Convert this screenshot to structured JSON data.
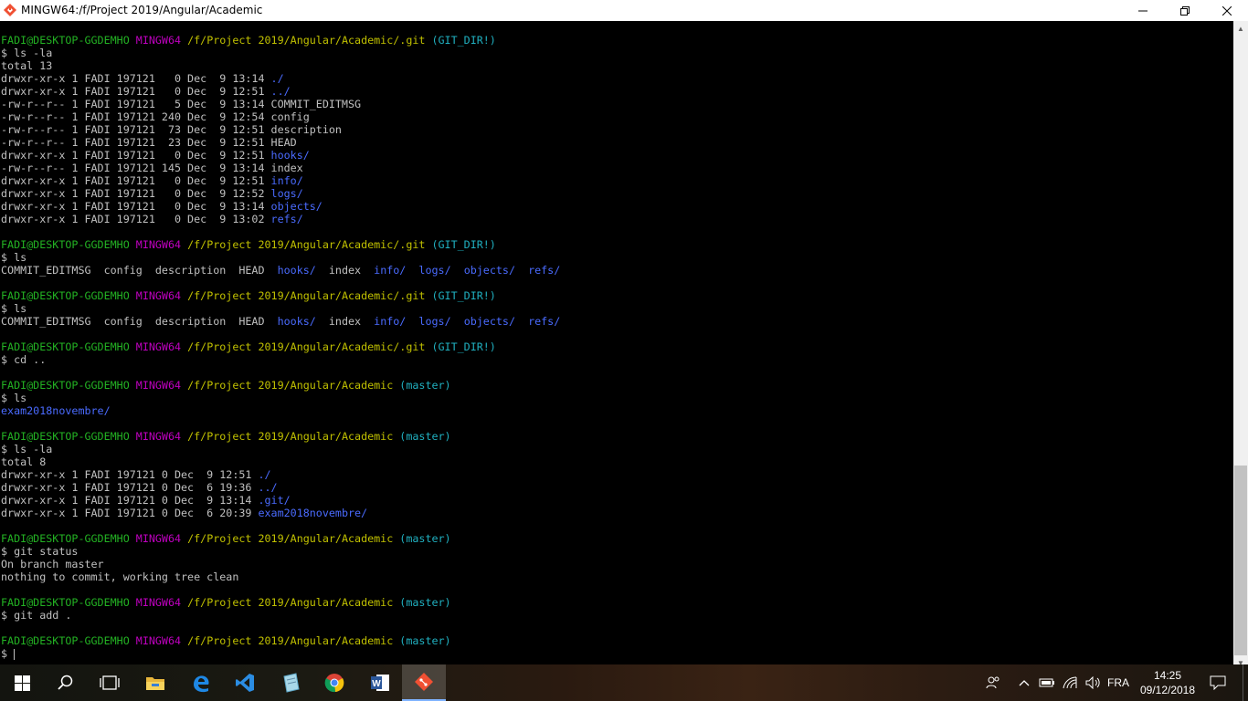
{
  "window": {
    "title": "MINGW64:/f/Project 2019/Angular/Academic",
    "minimize_glyph": "—",
    "maximize_glyph": "❐",
    "close_glyph": "✕"
  },
  "terminal": {
    "lines": [
      [
        [
          "FADI@DESKTOP-GGDEMHO ",
          "user"
        ],
        [
          "MINGW64 ",
          "sys"
        ],
        [
          "/f/Project 2019/Angular/Academic/.git ",
          "path"
        ],
        [
          "(GIT_DIR!)",
          "branch"
        ]
      ],
      [
        [
          "$ ls -la",
          "plain"
        ]
      ],
      [
        [
          "total 13",
          "plain"
        ]
      ],
      [
        [
          "drwxr-xr-x 1 FADI 197121   0 Dec  9 13:14 ",
          "plain"
        ],
        [
          "./",
          "dir"
        ]
      ],
      [
        [
          "drwxr-xr-x 1 FADI 197121   0 Dec  9 12:51 ",
          "plain"
        ],
        [
          "../",
          "dir"
        ]
      ],
      [
        [
          "-rw-r--r-- 1 FADI 197121   5 Dec  9 13:14 COMMIT_EDITMSG",
          "plain"
        ]
      ],
      [
        [
          "-rw-r--r-- 1 FADI 197121 240 Dec  9 12:54 config",
          "plain"
        ]
      ],
      [
        [
          "-rw-r--r-- 1 FADI 197121  73 Dec  9 12:51 description",
          "plain"
        ]
      ],
      [
        [
          "-rw-r--r-- 1 FADI 197121  23 Dec  9 12:51 HEAD",
          "plain"
        ]
      ],
      [
        [
          "drwxr-xr-x 1 FADI 197121   0 Dec  9 12:51 ",
          "plain"
        ],
        [
          "hooks/",
          "dir"
        ]
      ],
      [
        [
          "-rw-r--r-- 1 FADI 197121 145 Dec  9 13:14 index",
          "plain"
        ]
      ],
      [
        [
          "drwxr-xr-x 1 FADI 197121   0 Dec  9 12:51 ",
          "plain"
        ],
        [
          "info/",
          "dir"
        ]
      ],
      [
        [
          "drwxr-xr-x 1 FADI 197121   0 Dec  9 12:52 ",
          "plain"
        ],
        [
          "logs/",
          "dir"
        ]
      ],
      [
        [
          "drwxr-xr-x 1 FADI 197121   0 Dec  9 13:14 ",
          "plain"
        ],
        [
          "objects/",
          "dir"
        ]
      ],
      [
        [
          "drwxr-xr-x 1 FADI 197121   0 Dec  9 13:02 ",
          "plain"
        ],
        [
          "refs/",
          "dir"
        ]
      ],
      [],
      [
        [
          "FADI@DESKTOP-GGDEMHO ",
          "user"
        ],
        [
          "MINGW64 ",
          "sys"
        ],
        [
          "/f/Project 2019/Angular/Academic/.git ",
          "path"
        ],
        [
          "(GIT_DIR!)",
          "branch"
        ]
      ],
      [
        [
          "$ ls",
          "plain"
        ]
      ],
      [
        [
          "COMMIT_EDITMSG  config  description  HEAD  ",
          "plain"
        ],
        [
          "hooks/",
          "dir"
        ],
        [
          "  index  ",
          "plain"
        ],
        [
          "info/",
          "dir"
        ],
        [
          "  ",
          "plain"
        ],
        [
          "logs/",
          "dir"
        ],
        [
          "  ",
          "plain"
        ],
        [
          "objects/",
          "dir"
        ],
        [
          "  ",
          "plain"
        ],
        [
          "refs/",
          "dir"
        ]
      ],
      [],
      [
        [
          "FADI@DESKTOP-GGDEMHO ",
          "user"
        ],
        [
          "MINGW64 ",
          "sys"
        ],
        [
          "/f/Project 2019/Angular/Academic/.git ",
          "path"
        ],
        [
          "(GIT_DIR!)",
          "branch"
        ]
      ],
      [
        [
          "$ ls",
          "plain"
        ]
      ],
      [
        [
          "COMMIT_EDITMSG  config  description  HEAD  ",
          "plain"
        ],
        [
          "hooks/",
          "dir"
        ],
        [
          "  index  ",
          "plain"
        ],
        [
          "info/",
          "dir"
        ],
        [
          "  ",
          "plain"
        ],
        [
          "logs/",
          "dir"
        ],
        [
          "  ",
          "plain"
        ],
        [
          "objects/",
          "dir"
        ],
        [
          "  ",
          "plain"
        ],
        [
          "refs/",
          "dir"
        ]
      ],
      [],
      [
        [
          "FADI@DESKTOP-GGDEMHO ",
          "user"
        ],
        [
          "MINGW64 ",
          "sys"
        ],
        [
          "/f/Project 2019/Angular/Academic/.git ",
          "path"
        ],
        [
          "(GIT_DIR!)",
          "branch"
        ]
      ],
      [
        [
          "$ cd ..",
          "plain"
        ]
      ],
      [],
      [
        [
          "FADI@DESKTOP-GGDEMHO ",
          "user"
        ],
        [
          "MINGW64 ",
          "sys"
        ],
        [
          "/f/Project 2019/Angular/Academic ",
          "path"
        ],
        [
          "(master)",
          "branch"
        ]
      ],
      [
        [
          "$ ls",
          "plain"
        ]
      ],
      [
        [
          "exam2018novembre/",
          "dir"
        ]
      ],
      [],
      [
        [
          "FADI@DESKTOP-GGDEMHO ",
          "user"
        ],
        [
          "MINGW64 ",
          "sys"
        ],
        [
          "/f/Project 2019/Angular/Academic ",
          "path"
        ],
        [
          "(master)",
          "branch"
        ]
      ],
      [
        [
          "$ ls -la",
          "plain"
        ]
      ],
      [
        [
          "total 8",
          "plain"
        ]
      ],
      [
        [
          "drwxr-xr-x 1 FADI 197121 0 Dec  9 12:51 ",
          "plain"
        ],
        [
          "./",
          "dir"
        ]
      ],
      [
        [
          "drwxr-xr-x 1 FADI 197121 0 Dec  6 19:36 ",
          "plain"
        ],
        [
          "../",
          "dir"
        ]
      ],
      [
        [
          "drwxr-xr-x 1 FADI 197121 0 Dec  9 13:14 ",
          "plain"
        ],
        [
          ".git/",
          "dir"
        ]
      ],
      [
        [
          "drwxr-xr-x 1 FADI 197121 0 Dec  6 20:39 ",
          "plain"
        ],
        [
          "exam2018novembre/",
          "dir"
        ]
      ],
      [],
      [
        [
          "FADI@DESKTOP-GGDEMHO ",
          "user"
        ],
        [
          "MINGW64 ",
          "sys"
        ],
        [
          "/f/Project 2019/Angular/Academic ",
          "path"
        ],
        [
          "(master)",
          "branch"
        ]
      ],
      [
        [
          "$ git status",
          "plain"
        ]
      ],
      [
        [
          "On branch master",
          "plain"
        ]
      ],
      [
        [
          "nothing to commit, working tree clean",
          "plain"
        ]
      ],
      [],
      [
        [
          "FADI@DESKTOP-GGDEMHO ",
          "user"
        ],
        [
          "MINGW64 ",
          "sys"
        ],
        [
          "/f/Project 2019/Angular/Academic ",
          "path"
        ],
        [
          "(master)",
          "branch"
        ]
      ],
      [
        [
          "$ git add .",
          "plain"
        ]
      ],
      [],
      [
        [
          "FADI@DESKTOP-GGDEMHO ",
          "user"
        ],
        [
          "MINGW64 ",
          "sys"
        ],
        [
          "/f/Project 2019/Angular/Academic ",
          "path"
        ],
        [
          "(master)",
          "branch"
        ]
      ]
    ],
    "prompt": "$ "
  },
  "taskbar": {
    "apps": [
      "start-icon",
      "search-icon",
      "task-view-icon",
      "file-explorer-icon",
      "edge-icon",
      "vscode-icon",
      "notepad-icon",
      "chrome-icon",
      "word-icon",
      "git-bash-icon"
    ],
    "active_app": "git-bash-icon",
    "language": "FRA",
    "time": "14:25",
    "date": "09/12/2018"
  },
  "colors": {
    "user": "#23b223",
    "system": "#c000c0",
    "path": "#c0c000",
    "branch": "#20b0c0",
    "directory": "#4a6bff",
    "text": "#c0c0c0"
  }
}
